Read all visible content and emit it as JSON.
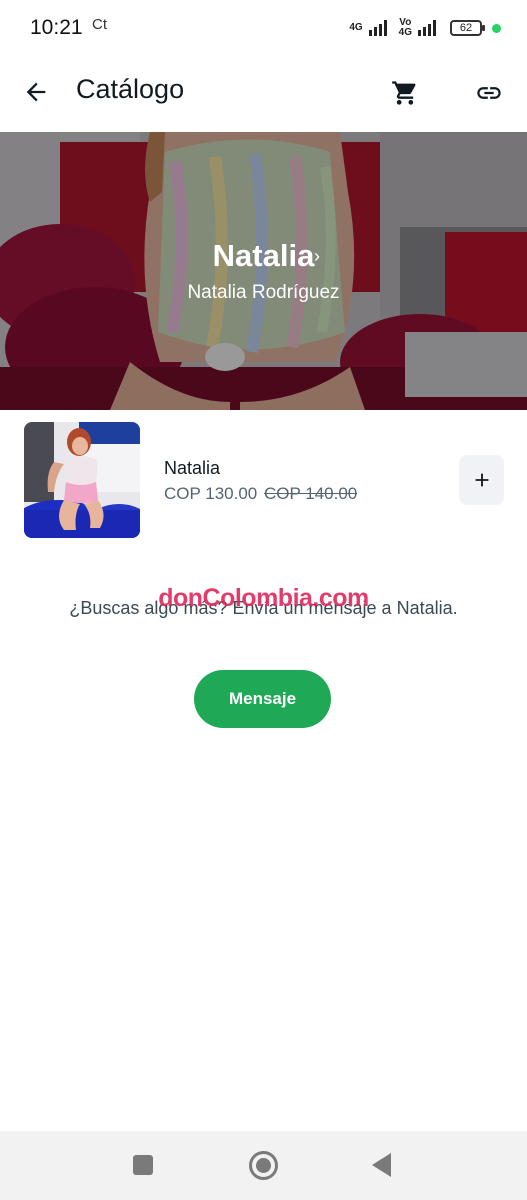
{
  "status_bar": {
    "time": "10:21",
    "app_indicator": "Ct",
    "sim1_label": "4G",
    "sim2_label_top": "Vo",
    "sim2_label_bottom": "4G",
    "battery": "62",
    "online_dot_color": "#25d366"
  },
  "app_bar": {
    "title": "Catálogo",
    "back_icon": "arrow-left-icon",
    "cart_icon": "cart-icon",
    "link_icon": "link-icon"
  },
  "hero": {
    "name": "Natalia",
    "chevron": "›",
    "subtitle": "Natalia Rodríguez"
  },
  "product": {
    "name": "Natalia",
    "price": "COP 130.00",
    "old_price": "COP 140.00",
    "add_icon": "plus-icon"
  },
  "prompt": {
    "text": "¿Buscas algo más? Envía un mensaje a Natalia.",
    "watermark": "donColombia.com"
  },
  "message_button": {
    "label": "Mensaje",
    "color": "#1fa855"
  },
  "nav_bar": {
    "recent_icon": "square-icon",
    "home_icon": "circle-icon",
    "back_icon": "triangle-back-icon"
  }
}
